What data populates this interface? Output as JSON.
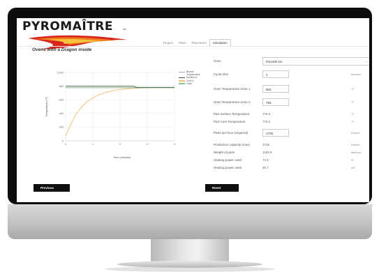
{
  "brand": {
    "name": "PYROMAÎTRE",
    "inc": "INC.",
    "tagline": "Ovens with a Dragon inside"
  },
  "tabs": [
    "Project",
    "Parts",
    "Placement",
    "Simulation"
  ],
  "active_tab": "Simulation",
  "form": {
    "oven": {
      "label": "Oven",
      "value": "PS1200 4m"
    },
    "cycle_time": {
      "label": "Cycle time",
      "value": "4",
      "unit": "minutes"
    },
    "zone1": {
      "label": "Oven Temperature Zone 1",
      "value": "803",
      "unit": "°F"
    },
    "zone2": {
      "label": "Oven Temperature Zone 2",
      "value": "783",
      "unit": "°F"
    },
    "surface_temp": {
      "label": "Part Surface Temperature",
      "value": "776.3",
      "unit": "°F"
    },
    "core_temp": {
      "label": "Part Core Temperature",
      "value": "776.2",
      "unit": "°F"
    },
    "parts_per_hour": {
      "label": "Parts per hour (required)",
      "value": "1700",
      "unit": "Parts/h"
    },
    "capacity": {
      "label": "Production capacity (max)",
      "value": "1726",
      "unit": "Parts/h"
    },
    "weight": {
      "label": "Weight of parts",
      "value": "1193.9",
      "unit": "lbs/hour"
    },
    "heating_used_pct": {
      "label": "Heating power used",
      "value": "74.9",
      "unit": "%"
    },
    "heating_used_kw": {
      "label": "Heating power used",
      "value": "30.7",
      "unit": "kW"
    }
  },
  "buttons": {
    "previous": "Previous",
    "reset": "Reset"
  },
  "chart_data": {
    "type": "line",
    "xlabel": "Time (minutes)",
    "ylabel": "Temperature (°F)",
    "xlim": [
      0,
      4
    ],
    "ylim": [
      0,
      1000
    ],
    "xticks": [
      "0",
      "1",
      "2",
      "3",
      "4"
    ],
    "yticks": [
      "0",
      "200",
      "400",
      "600",
      "800",
      "1,000"
    ],
    "grid": true,
    "legend_position": "right",
    "series": [
      {
        "name": "Blower Temperature",
        "color": "#9fa5b8",
        "x": [
          0,
          4
        ],
        "y": [
          778,
          778
        ]
      },
      {
        "name": "Surface A",
        "color": "#3f5f45",
        "x": [
          0,
          2.5,
          2.6,
          4
        ],
        "y": [
          800,
          800,
          783,
          783
        ]
      },
      {
        "name": "Core A",
        "color": "#f2c078",
        "x": [
          0,
          0.2,
          0.4,
          0.6,
          0.8,
          1,
          1.2,
          1.5,
          1.8,
          2.2,
          2.6,
          3,
          3.5,
          4
        ],
        "y": [
          70,
          255,
          400,
          500,
          575,
          630,
          670,
          712,
          740,
          760,
          770,
          775,
          777,
          778
        ]
      },
      {
        "name": "Oven",
        "color": "#8dc48f",
        "x": [
          0,
          4
        ],
        "y": [
          778,
          778
        ]
      }
    ]
  }
}
